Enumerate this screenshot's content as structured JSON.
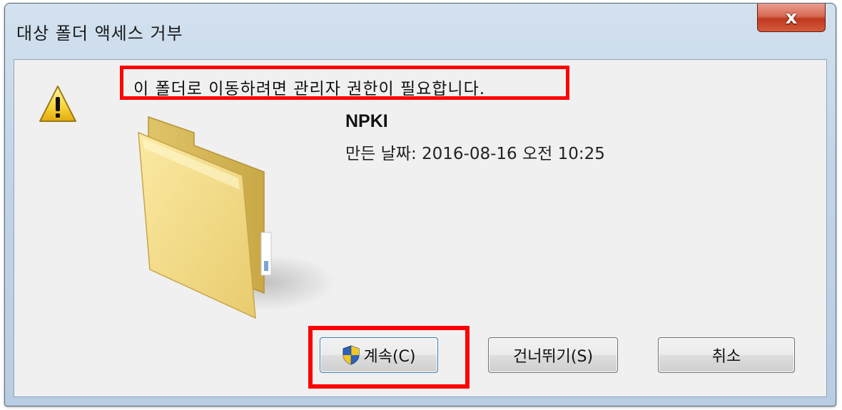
{
  "window": {
    "title": "대상 폴더 액세스 거부",
    "close_label": "x"
  },
  "dialog": {
    "message": "이 폴더로 이동하려면 관리자 권한이 필요합니다.",
    "folder_name": "NPKI",
    "folder_date": "만든 날짜: 2016-08-16 오전 10:25"
  },
  "buttons": {
    "continue": "계속(C)",
    "skip": "건너뛰기(S)",
    "cancel": "취소"
  },
  "icons": {
    "warning": "warning-icon",
    "folder": "folder-icon",
    "shield": "uac-shield-icon"
  },
  "colors": {
    "highlight": "#ff0000",
    "dialog_bg": "#f0f0f0",
    "close_button": "#c0391f"
  }
}
